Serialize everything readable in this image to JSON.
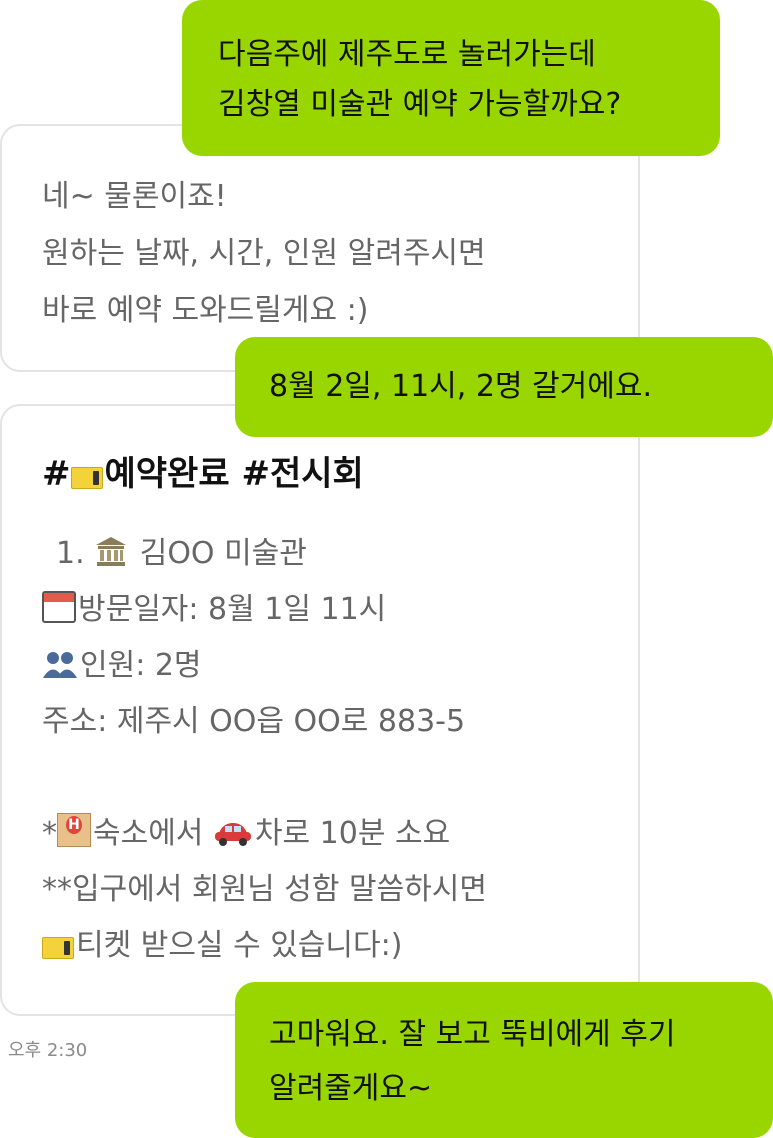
{
  "messages": [
    {
      "side": "user",
      "lines": [
        "다음주에 제주도로 놀러가는데",
        "김창열 미술관  예약 가능할까요?"
      ]
    },
    {
      "side": "bot",
      "lines": [
        "네~ 물론이죠!",
        "원하는 날짜, 시간, 인원 알려주시면",
        "바로 예약 도와드릴게요 :)"
      ]
    },
    {
      "side": "user",
      "lines": [
        "8월 2일, 11시, 2명 갈거에요."
      ]
    },
    {
      "side": "bot",
      "title_prefix": "#",
      "title": "예약완료 #전시회",
      "item_number": "1.",
      "item_name": "김OO 미술관",
      "visit_date": "방문일자: 8월 1일 11시",
      "people": "인원: 2명",
      "address": "주소: 제주시 OO읍 OO로 883-5",
      "note1_prefix": "*",
      "note1_a": "숙소에서 ",
      "note1_b": "차로 10분 소요",
      "note2": "**입구에서 회원님 성함 말씀하시면",
      "note3": "티켓 받으실 수 있습니다:)"
    },
    {
      "side": "user",
      "lines": [
        "고마워요. 잘 보고 뚝비에게 후기",
        "알려줄게요~"
      ]
    }
  ],
  "timestamp": "오후 2:30",
  "icons": {
    "ticket": "ticket-icon",
    "museum": "museum-icon",
    "calendar": "calendar-icon",
    "people": "people-icon",
    "hotel": "hotel-icon",
    "car": "car-icon"
  },
  "colors": {
    "user_bubble": "#99d600",
    "bot_bubble_border": "#e3e3e3",
    "bot_text": "#666666"
  }
}
